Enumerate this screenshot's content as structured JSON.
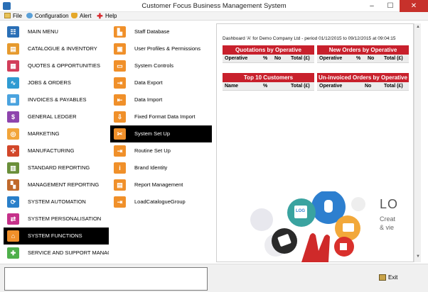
{
  "window": {
    "title": "Customer Focus Business Management System",
    "minimize": "–",
    "maximize": "☐",
    "close": "✕"
  },
  "menu": [
    {
      "label": "File",
      "icon": "folder-icon"
    },
    {
      "label": "Configuration",
      "icon": "gear-icon"
    },
    {
      "label": "Alert",
      "icon": "bell-icon"
    },
    {
      "label": "Help",
      "icon": "plus-icon"
    }
  ],
  "main_nav": [
    {
      "label": "MAIN MENU",
      "icon": "hierarchy-icon",
      "color": "#2a6fb6",
      "glyph": "☷"
    },
    {
      "label": "CATALOGUE & INVENTORY",
      "icon": "catalogue-icon",
      "color": "#e69a2e",
      "glyph": "▤"
    },
    {
      "label": "QUOTES & OPPORTUNITIES",
      "icon": "quotes-icon",
      "color": "#d23e5a",
      "glyph": "▦"
    },
    {
      "label": "JOBS & ORDERS",
      "icon": "pulse-icon",
      "color": "#2f9bd2",
      "glyph": "∿"
    },
    {
      "label": "INVOICES & PAYABLES",
      "icon": "calculator-icon",
      "color": "#4aa3df",
      "glyph": "▦"
    },
    {
      "label": "GENERAL LEDGER",
      "icon": "dollar-icon",
      "color": "#8e44ad",
      "glyph": "$"
    },
    {
      "label": "MARKETING",
      "icon": "globe-icon",
      "color": "#f2a53a",
      "glyph": "◎"
    },
    {
      "label": "MANUFACTURING",
      "icon": "network-icon",
      "color": "#d2472a",
      "glyph": "✣"
    },
    {
      "label": "STANDARD REPORTING",
      "icon": "report-icon",
      "color": "#6a8f3a",
      "glyph": "▥"
    },
    {
      "label": "MANAGEMENT REPORTING",
      "icon": "chart-icon",
      "color": "#c0692b",
      "glyph": "▚"
    },
    {
      "label": "SYSTEM AUTOMATION",
      "icon": "automation-icon",
      "color": "#2a7fc9",
      "glyph": "⟳"
    },
    {
      "label": "SYSTEM PERSONALISATION",
      "icon": "personalise-icon",
      "color": "#c5318a",
      "glyph": "⇄"
    },
    {
      "label": "SYSTEM FUNCTIONS",
      "icon": "home-icon",
      "color": "#f0902a",
      "glyph": "⌂",
      "selected": true
    },
    {
      "label": "SERVICE AND SUPPORT MANAGEM",
      "icon": "support-icon",
      "color": "#4fb04b",
      "glyph": "✚"
    }
  ],
  "sub_nav": [
    {
      "label": "Staff Database",
      "icon": "staff-database-icon",
      "glyph": "▙"
    },
    {
      "label": "User Profiles & Permissions",
      "icon": "user-profiles-icon",
      "glyph": "▣"
    },
    {
      "label": "System Controls",
      "icon": "system-controls-icon",
      "glyph": "▭"
    },
    {
      "label": "Data Export",
      "icon": "data-export-icon",
      "glyph": "⇥"
    },
    {
      "label": "Data Import",
      "icon": "data-import-icon",
      "glyph": "⇤"
    },
    {
      "label": "Fixed Format Data Import",
      "icon": "fixed-import-icon",
      "glyph": "⇩"
    },
    {
      "label": "System Set Up",
      "icon": "setup-icon",
      "glyph": "✂",
      "selected": true
    },
    {
      "label": "Routine Set Up",
      "icon": "routine-icon",
      "glyph": "⇥"
    },
    {
      "label": "Brand Identity",
      "icon": "brand-icon",
      "glyph": "i"
    },
    {
      "label": "Report Management",
      "icon": "report-management-icon",
      "glyph": "▤"
    },
    {
      "label": "LoadCatalogueGroup",
      "icon": "load-catalogue-icon",
      "glyph": "⇥"
    }
  ],
  "dashboard": {
    "subtitle": "Dashboard 'A' for Demo Company Ltd - period 01/12/2015 to 09/12/2015 at 09:04:15",
    "widgets": [
      {
        "title": "Quotations by Operative",
        "columns": [
          "Operative",
          "%",
          "No",
          "Total (£)"
        ]
      },
      {
        "title": "New Orders by Operative",
        "columns": [
          "Operative",
          "%",
          "No",
          "Total (£)"
        ]
      },
      {
        "title": "Top 10 Customers",
        "columns": [
          "Name",
          "%",
          "Total (£)"
        ]
      },
      {
        "title": "Un-invoiced Orders by Operative",
        "columns": [
          "Operative",
          "No",
          "Total (£)"
        ]
      }
    ],
    "logo_text": "LO",
    "logo_line1": "Creat",
    "logo_line2": "& vie",
    "logo_bubbles": [
      "LOG"
    ]
  },
  "footer": {
    "exit_label": "Exit"
  },
  "colors": {
    "accent_red": "#c8202c",
    "selected_bg": "#000000",
    "sub_icon": "#f0902a"
  }
}
